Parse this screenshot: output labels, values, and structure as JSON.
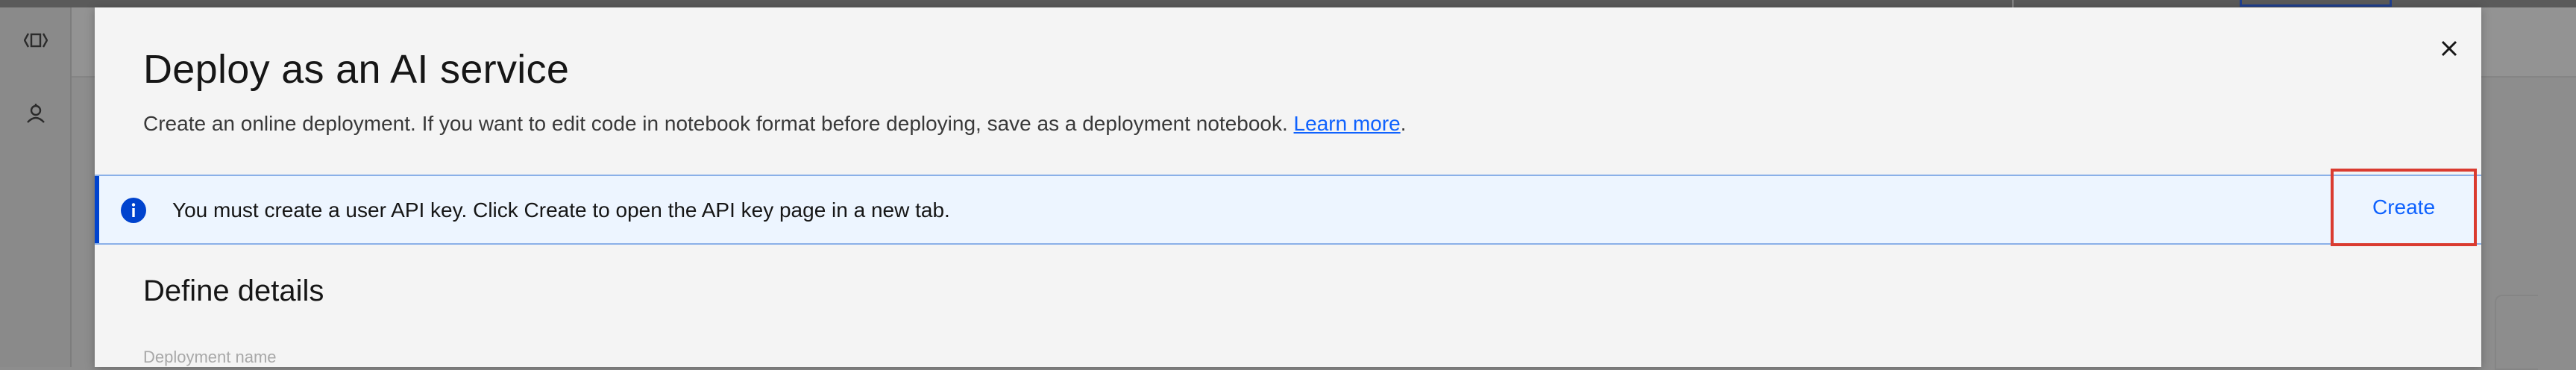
{
  "modal": {
    "title": "Deploy as an AI service",
    "subtitle_text": "Create an online deployment. If you want to edit code in notebook format before deploying, save as a deployment notebook. ",
    "subtitle_link": "Learn more",
    "subtitle_end": "."
  },
  "notification": {
    "type": "info",
    "message": "You must create a user API key. Click Create to open the API key page in a new tab.",
    "action_label": "Create",
    "accent_color": "#0043ce",
    "highlight_color": "#da3b30"
  },
  "form": {
    "section_title": "Define details",
    "deployment_name_label": "Deployment name"
  },
  "icons": {
    "close": "close-icon",
    "info": "info-icon",
    "sidebar": [
      "code-brackets-icon",
      "bot-icon"
    ]
  }
}
